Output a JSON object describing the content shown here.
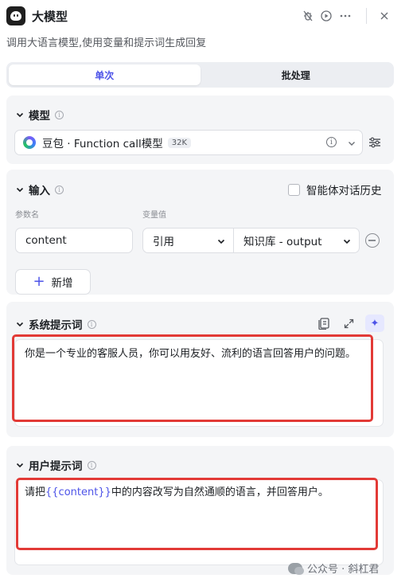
{
  "header": {
    "title": "大模型",
    "description": "调用大语言模型,使用变量和提示词生成回复",
    "icons": [
      "bug-off-icon",
      "play-icon",
      "more-icon",
      "close-icon"
    ]
  },
  "tabs": [
    {
      "label": "单次",
      "active": true
    },
    {
      "label": "批处理",
      "active": false
    }
  ],
  "model_section": {
    "title": "模型",
    "model_name": "豆包 · Function call模型",
    "context_badge": "32K"
  },
  "input_section": {
    "title": "输入",
    "history_checkbox_label": "智能体对话历史",
    "history_checked": false,
    "param_name_header": "参数名",
    "param_value_header": "变量值",
    "rows": [
      {
        "name": "content",
        "type": "引用",
        "value": "知识库 - output"
      }
    ],
    "add_label": "新增"
  },
  "system_prompt": {
    "title": "系统提示词",
    "text": "你是一个专业的客服人员，你可以用友好、流利的语言回答用户的问题。"
  },
  "user_prompt": {
    "title": "用户提示词",
    "prefix": "请把",
    "variable": "{{content}}",
    "suffix": "中的内容改写为自然通顺的语言，并回答用户。"
  },
  "watermark": {
    "text": "公众号 · 斜杠君"
  },
  "colors": {
    "accent": "#4d53e8",
    "highlight_frame": "#e23a36",
    "card_bg": "#f4f5f7"
  }
}
